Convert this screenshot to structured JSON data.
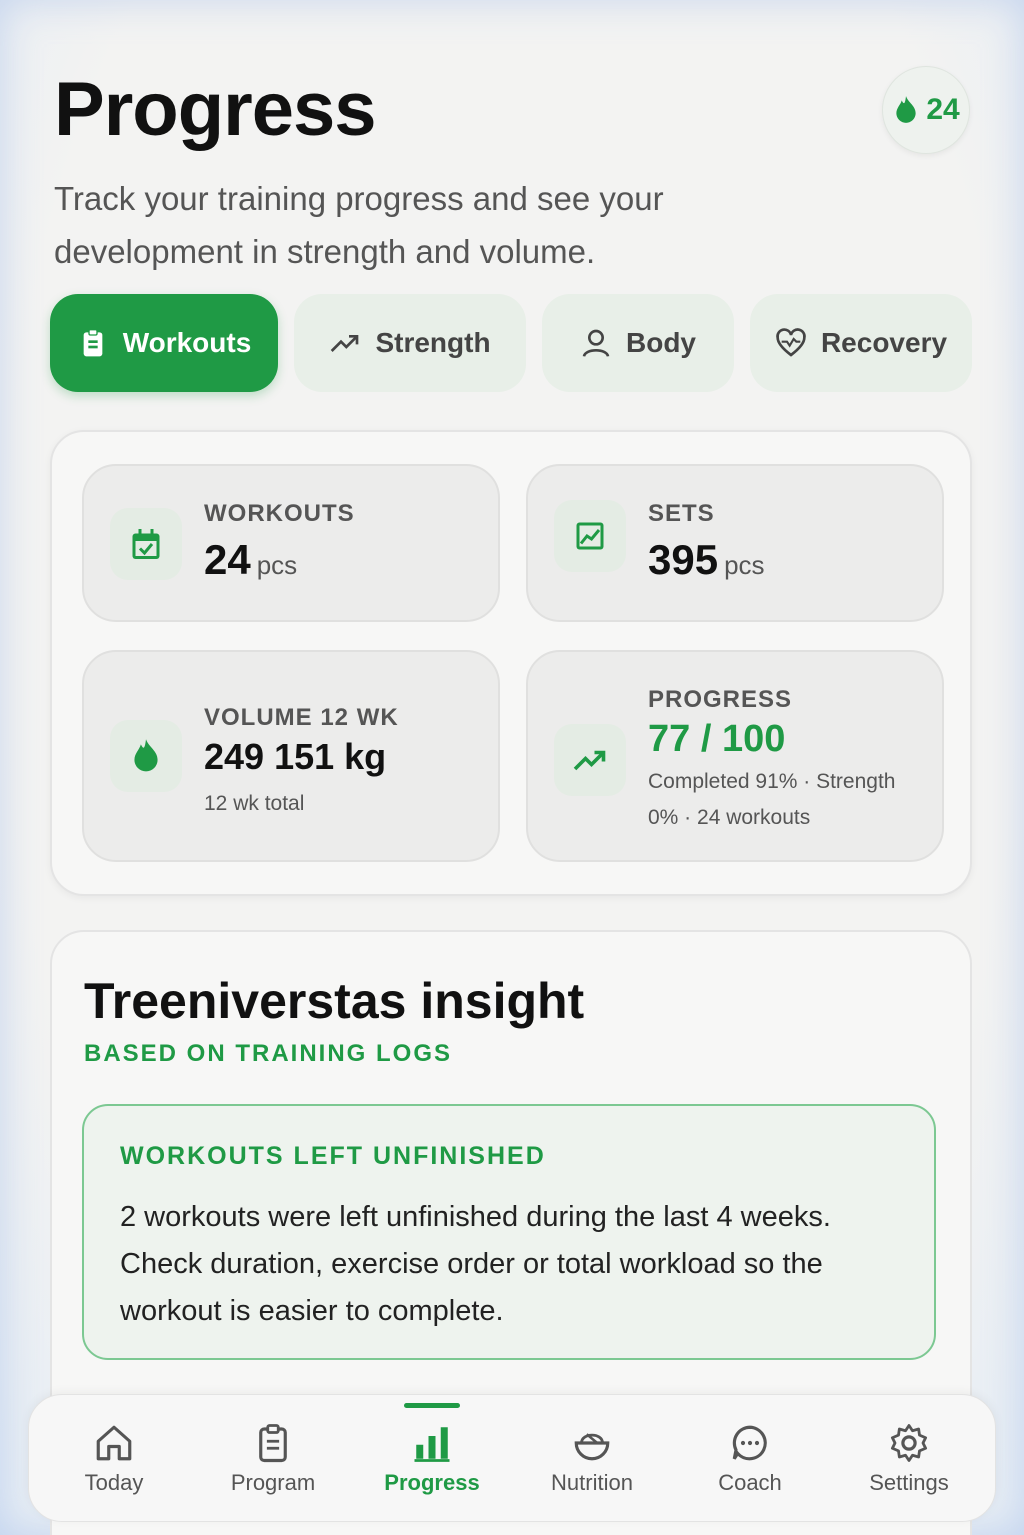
{
  "header": {
    "title": "Progress",
    "subtitle": "Track your training progress and see your development in strength and volume.",
    "streak": "24"
  },
  "tabs": [
    {
      "label": "Workouts",
      "icon": "clipboard-icon",
      "active": true
    },
    {
      "label": "Strength",
      "icon": "trend-up-icon",
      "active": false
    },
    {
      "label": "Body",
      "icon": "person-icon",
      "active": false
    },
    {
      "label": "Recovery",
      "icon": "heart-pulse-icon",
      "active": false
    }
  ],
  "stats": {
    "workouts": {
      "label": "WORKOUTS",
      "value": "24",
      "unit": "pcs"
    },
    "sets": {
      "label": "SETS",
      "value": "395",
      "unit": "pcs"
    },
    "volume": {
      "label": "VOLUME 12 WK",
      "value": "249 151 kg",
      "note": "12 wk total"
    },
    "progress": {
      "label": "PROGRESS",
      "value": "77 / 100",
      "note": "Completed 91% · Strength 0% · 24 workouts"
    }
  },
  "insight": {
    "title": "Treeniverstas insight",
    "subtitle": "BASED ON TRAINING LOGS",
    "box_head": "WORKOUTS LEFT UNFINISHED",
    "box_body": "2 workouts were left unfinished during the last 4 weeks. Check duration, exercise order or total workload so the workout is easier to complete."
  },
  "nav": [
    {
      "label": "Today",
      "icon": "home-icon"
    },
    {
      "label": "Program",
      "icon": "clipboard-icon"
    },
    {
      "label": "Progress",
      "icon": "bar-chart-icon",
      "active": true
    },
    {
      "label": "Nutrition",
      "icon": "bowl-icon"
    },
    {
      "label": "Coach",
      "icon": "chat-icon"
    },
    {
      "label": "Settings",
      "icon": "gear-icon"
    }
  ],
  "colors": {
    "accent": "#1f9a45",
    "background": "#f1f2f1"
  }
}
